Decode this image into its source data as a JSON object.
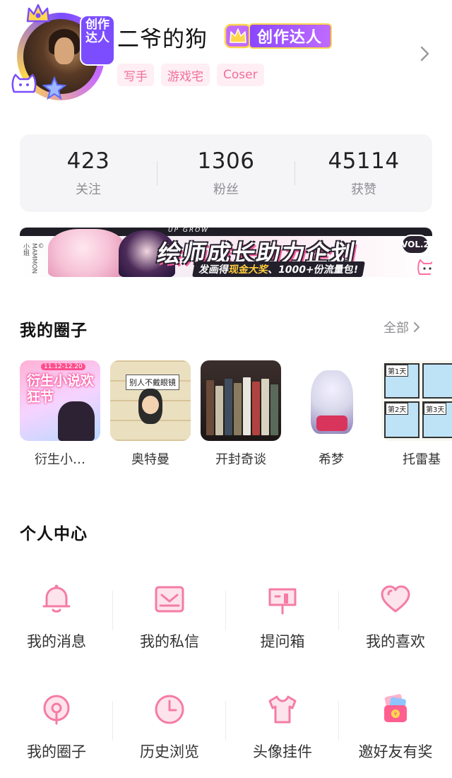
{
  "profile": {
    "avatar_badge_text": "创作达人",
    "username": "二爷的狗",
    "creator_badge_label": "创作达人",
    "tags": [
      "写手",
      "游戏宅",
      "Coser"
    ]
  },
  "stats": [
    {
      "value": "423",
      "label": "关注"
    },
    {
      "value": "1306",
      "label": "粉丝"
    },
    {
      "value": "45114",
      "label": "获赞"
    }
  ],
  "banner": {
    "title": "绘师成长助力企划",
    "sub_prefix": "发画得",
    "sub_highlight": "现金大奖",
    "sub_suffix": "、1000+份流量包!",
    "vol": "VOL.2",
    "strip_text": "UP GROW",
    "copyright": "© MAMMON小姐"
  },
  "circles_section": {
    "title": "我的圈子",
    "see_all": "全部",
    "items": [
      {
        "name": "衍生小…",
        "thumb_text": "衍生小说欢狂节",
        "thumb_date": "11.12-12.20"
      },
      {
        "name": "奥特曼",
        "thumb_text": "别人不戴眼镜"
      },
      {
        "name": "开封奇谈"
      },
      {
        "name": "希梦"
      },
      {
        "name": "托雷基",
        "thumb_labels": [
          "第1天",
          "第2天",
          "第3天"
        ]
      }
    ]
  },
  "personal_center": {
    "title": "个人中心",
    "items": [
      {
        "label": "我的消息",
        "icon": "bell-icon"
      },
      {
        "label": "我的私信",
        "icon": "envelope-icon"
      },
      {
        "label": "提问箱",
        "icon": "mailbox-icon"
      },
      {
        "label": "我的喜欢",
        "icon": "heart-icon"
      },
      {
        "label": "我的圈子",
        "icon": "location-pin-icon"
      },
      {
        "label": "历史浏览",
        "icon": "clock-icon"
      },
      {
        "label": "头像挂件",
        "icon": "tshirt-icon"
      },
      {
        "label": "邀好友有奖",
        "icon": "gift-wallet-icon"
      }
    ]
  },
  "colors": {
    "accent_pink": "#ef6f98",
    "icon_pink": "#f47ca6",
    "icon_fill": "#fde3ec",
    "creator_purple": "#8a47ff",
    "stats_bg": "#f5f5f7"
  }
}
